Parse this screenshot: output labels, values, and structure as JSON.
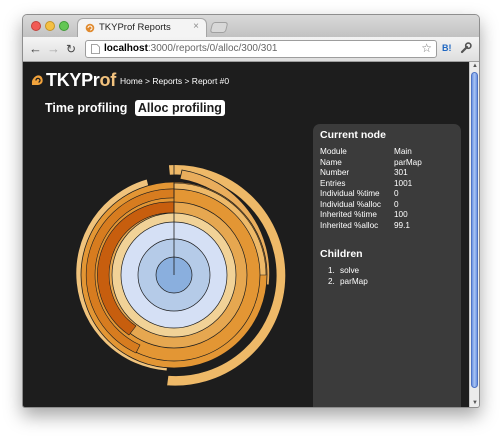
{
  "browser": {
    "tab_title": "TKYProf Reports",
    "tab_close": "×",
    "url_host": "localhost",
    "url_rest": ":3000/reports/0/alloc/300/301",
    "extension_label": "B!"
  },
  "app": {
    "logo_main": "TKYPr",
    "logo_accent": "of",
    "breadcrumb": "Home > Reports > Report #0",
    "tabs": [
      "Time profiling",
      "Alloc profiling"
    ],
    "active_tab": "Alloc profiling"
  },
  "current_node": {
    "title": "Current node",
    "rows": [
      {
        "label": "Module",
        "value": "Main"
      },
      {
        "label": "Name",
        "value": "parMap"
      },
      {
        "label": "Number",
        "value": "301"
      },
      {
        "label": "Entries",
        "value": "1001"
      },
      {
        "label": "Individual %time",
        "value": "0"
      },
      {
        "label": "Individual %alloc",
        "value": "0"
      },
      {
        "label": "Inherited %time",
        "value": "100"
      },
      {
        "label": "Inherited %alloc",
        "value": "99.1"
      }
    ]
  },
  "children": {
    "title": "Children",
    "items": [
      {
        "num": "1.",
        "label": "solve"
      },
      {
        "num": "2.",
        "label": "parMap"
      }
    ]
  },
  "colors": {
    "background": "#1d1d1d",
    "panel": "#3b3b3b",
    "ring_colors": [
      "#8aafde",
      "#b5cbe8",
      "#d5e0f5",
      "#f1d297",
      "#e6a750",
      "#ecb76a",
      "#f0c37c",
      "#d77c1f",
      "#c75e0e"
    ]
  }
}
